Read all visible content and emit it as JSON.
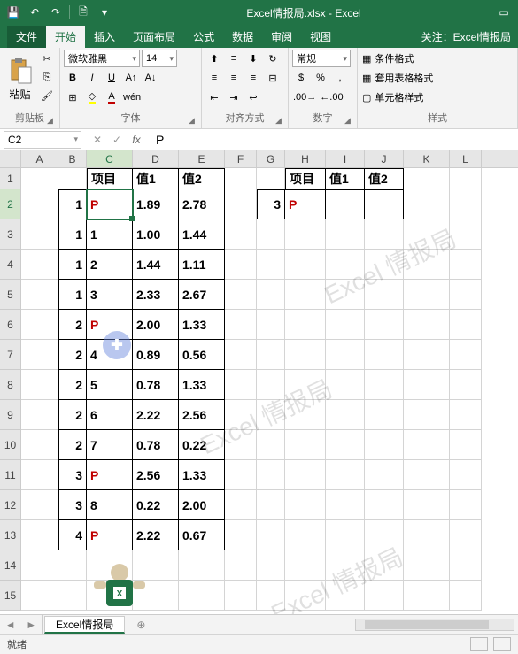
{
  "app": {
    "title": "Excel情报局.xlsx - Excel"
  },
  "tabs": {
    "file": "文件",
    "home": "开始",
    "insert": "插入",
    "layout": "页面布局",
    "formula": "公式",
    "data": "数据",
    "review": "审阅",
    "view": "视图",
    "follow": "关注：Excel情报局"
  },
  "ribbon": {
    "clipboard": {
      "label": "剪贴板",
      "paste": "粘贴"
    },
    "font": {
      "label": "字体",
      "name": "微软雅黑",
      "size": "14",
      "bold": "B",
      "italic": "I",
      "underline": "U"
    },
    "align": {
      "label": "对齐方式"
    },
    "number": {
      "label": "数字",
      "format": "常规"
    },
    "styles": {
      "label": "样式",
      "cond": "条件格式",
      "table": "套用表格格式",
      "cell": "单元格样式"
    }
  },
  "fbar": {
    "cell": "C2",
    "value": "P"
  },
  "cols": [
    "A",
    "B",
    "C",
    "D",
    "E",
    "F",
    "G",
    "H",
    "I",
    "J",
    "K",
    "L"
  ],
  "headers_left": {
    "c": "项目",
    "d": "值1",
    "e": "值2"
  },
  "headers_right": {
    "h": "项目",
    "i": "值1",
    "j": "值2"
  },
  "rows_left": [
    {
      "b": "1",
      "c": "P",
      "d": "1.89",
      "e": "2.78",
      "red": true
    },
    {
      "b": "1",
      "c": "1",
      "d": "1.00",
      "e": "1.44"
    },
    {
      "b": "1",
      "c": "2",
      "d": "1.44",
      "e": "1.11"
    },
    {
      "b": "1",
      "c": "3",
      "d": "2.33",
      "e": "2.67"
    },
    {
      "b": "2",
      "c": "P",
      "d": "2.00",
      "e": "1.33",
      "red": true
    },
    {
      "b": "2",
      "c": "4",
      "d": "0.89",
      "e": "0.56"
    },
    {
      "b": "2",
      "c": "5",
      "d": "0.78",
      "e": "1.33"
    },
    {
      "b": "2",
      "c": "6",
      "d": "2.22",
      "e": "2.56"
    },
    {
      "b": "2",
      "c": "7",
      "d": "0.78",
      "e": "0.22"
    },
    {
      "b": "3",
      "c": "P",
      "d": "2.56",
      "e": "1.33",
      "red": true
    },
    {
      "b": "3",
      "c": "8",
      "d": "0.22",
      "e": "2.00"
    },
    {
      "b": "4",
      "c": "P",
      "d": "2.22",
      "e": "0.67",
      "red": true
    }
  ],
  "row_right": {
    "g": "3",
    "h": "P",
    "red": true
  },
  "sheet": {
    "name": "Excel情报局"
  },
  "status": {
    "ready": "就绪"
  },
  "watermark": "Excel 情报局"
}
